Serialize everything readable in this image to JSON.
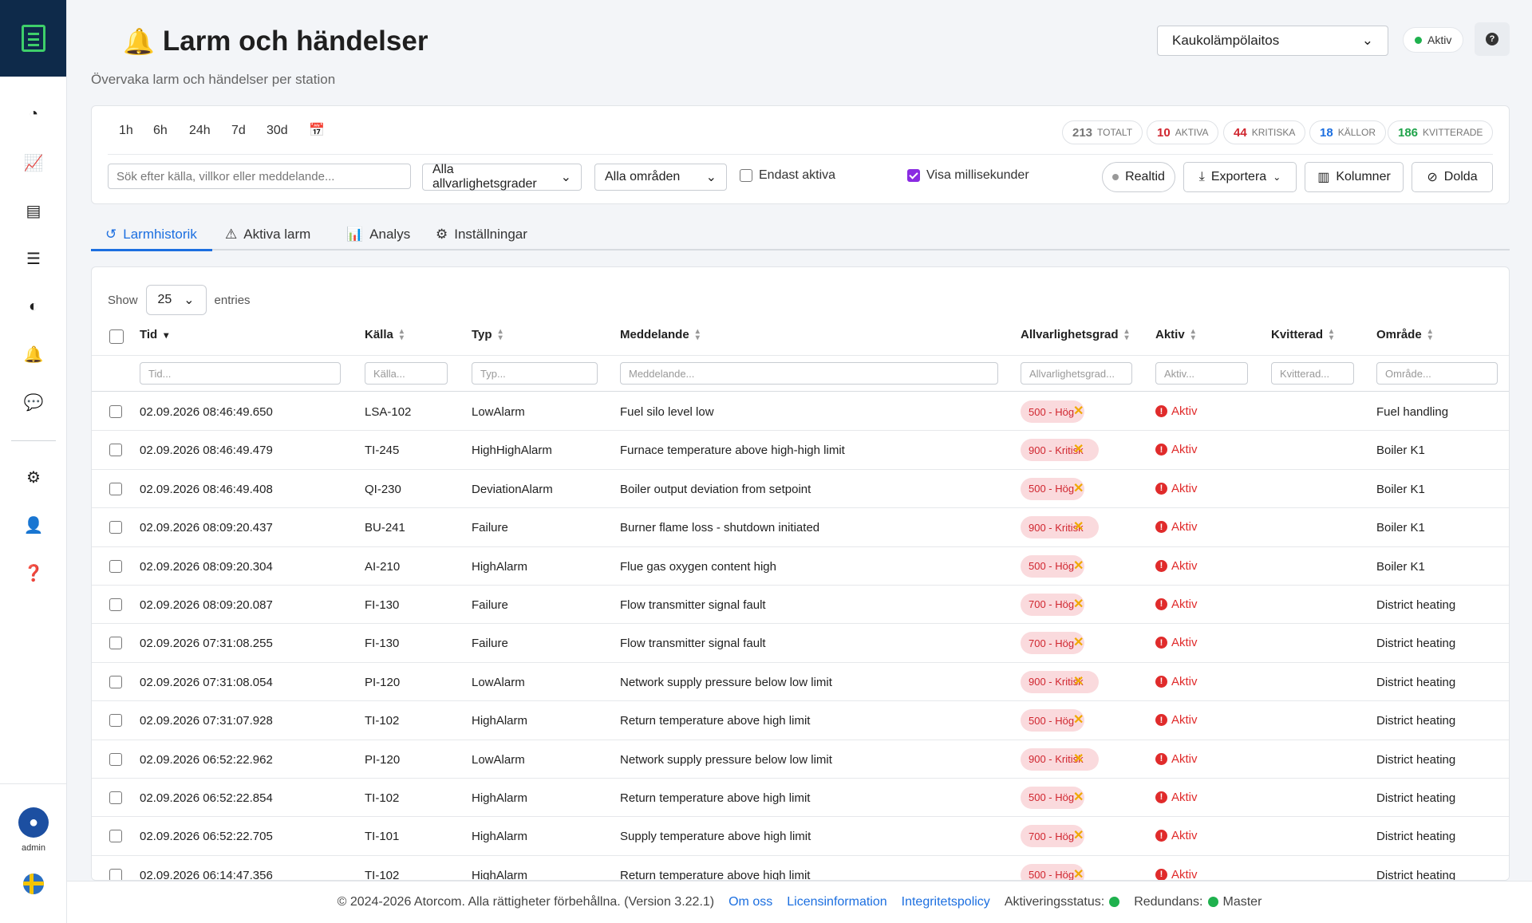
{
  "header": {
    "title": "Larm och händelser",
    "subtitle": "Övervaka larm och händelser per station",
    "station": "Kaukolämpölaitos",
    "status": "Aktiv",
    "help": "?"
  },
  "sidebar": {
    "user": "admin"
  },
  "ranges": [
    "1h",
    "6h",
    "24h",
    "7d",
    "30d"
  ],
  "stats": [
    {
      "num": "213",
      "label": "TOTALT",
      "color": "#222"
    },
    {
      "num": "10",
      "label": "AKTIVA",
      "color": "#d0262f"
    },
    {
      "num": "44",
      "label": "KRITISKA",
      "color": "#d0262f"
    },
    {
      "num": "18",
      "label": "KÄLLOR",
      "color": "#1c6fe0"
    },
    {
      "num": "186",
      "label": "KVITTERADE",
      "color": "#1fa34a"
    }
  ],
  "filters": {
    "search_placeholder": "Sök efter källa, villkor eller meddelande...",
    "severity": "Alla allvarlighetsgrader",
    "area": "Alla områden",
    "only_active": "Endast aktiva",
    "show_ms": "Visa millisekunder"
  },
  "tools": {
    "realtime": "Realtid",
    "export": "Exportera",
    "columns": "Kolumner",
    "hidden": "Dolda"
  },
  "tabs": [
    "Larmhistorik",
    "Aktiva larm",
    "Analys",
    "Inställningar"
  ],
  "table": {
    "show": "Show",
    "entries": "entries",
    "page_length": "25",
    "headers": [
      "Tid",
      "Källa",
      "Typ",
      "Meddelande",
      "Allvarlighetsgrad",
      "Aktiv",
      "Kvitterad",
      "Område"
    ],
    "filter_placeholders": [
      "Tid...",
      "Källa...",
      "Typ...",
      "Meddelande...",
      "Allvarlighetsgrad...",
      "Aktiv...",
      "Kvitterad...",
      "Område..."
    ],
    "rows": [
      {
        "time": "02.09.2026 08:46:49.650",
        "source": "LSA-102",
        "type": "LowAlarm",
        "message": "Fuel silo level low",
        "severity": "500 - Hög",
        "active": "Aktiv",
        "ack": "✕",
        "area": "Fuel handling"
      },
      {
        "time": "02.09.2026 08:46:49.479",
        "source": "TI-245",
        "type": "HighHighAlarm",
        "message": "Furnace temperature above high-high limit",
        "severity": "900 - Kritisk",
        "active": "Aktiv",
        "ack": "✕",
        "area": "Boiler K1"
      },
      {
        "time": "02.09.2026 08:46:49.408",
        "source": "QI-230",
        "type": "DeviationAlarm",
        "message": "Boiler output deviation from setpoint",
        "severity": "500 - Hög",
        "active": "Aktiv",
        "ack": "✕",
        "area": "Boiler K1"
      },
      {
        "time": "02.09.2026 08:09:20.437",
        "source": "BU-241",
        "type": "Failure",
        "message": "Burner flame loss - shutdown initiated",
        "severity": "900 - Kritisk",
        "active": "Aktiv",
        "ack": "✕",
        "area": "Boiler K1"
      },
      {
        "time": "02.09.2026 08:09:20.304",
        "source": "AI-210",
        "type": "HighAlarm",
        "message": "Flue gas oxygen content high",
        "severity": "500 - Hög",
        "active": "Aktiv",
        "ack": "✕",
        "area": "Boiler K1"
      },
      {
        "time": "02.09.2026 08:09:20.087",
        "source": "FI-130",
        "type": "Failure",
        "message": "Flow transmitter signal fault",
        "severity": "700 - Hög",
        "active": "Aktiv",
        "ack": "✕",
        "area": "District heating"
      },
      {
        "time": "02.09.2026 07:31:08.255",
        "source": "FI-130",
        "type": "Failure",
        "message": "Flow transmitter signal fault",
        "severity": "700 - Hög",
        "active": "Aktiv",
        "ack": "✕",
        "area": "District heating"
      },
      {
        "time": "02.09.2026 07:31:08.054",
        "source": "PI-120",
        "type": "LowAlarm",
        "message": "Network supply pressure below low limit",
        "severity": "900 - Kritisk",
        "active": "Aktiv",
        "ack": "✕",
        "area": "District heating"
      },
      {
        "time": "02.09.2026 07:31:07.928",
        "source": "TI-102",
        "type": "HighAlarm",
        "message": "Return temperature above high limit",
        "severity": "500 - Hög",
        "active": "Aktiv",
        "ack": "✕",
        "area": "District heating"
      },
      {
        "time": "02.09.2026 06:52:22.962",
        "source": "PI-120",
        "type": "LowAlarm",
        "message": "Network supply pressure below low limit",
        "severity": "900 - Kritisk",
        "active": "Aktiv",
        "ack": "✕",
        "area": "District heating"
      },
      {
        "time": "02.09.2026 06:52:22.854",
        "source": "TI-102",
        "type": "HighAlarm",
        "message": "Return temperature above high limit",
        "severity": "500 - Hög",
        "active": "Aktiv",
        "ack": "✕",
        "area": "District heating"
      },
      {
        "time": "02.09.2026 06:52:22.705",
        "source": "TI-101",
        "type": "HighAlarm",
        "message": "Supply temperature above high limit",
        "severity": "700 - Hög",
        "active": "Aktiv",
        "ack": "✕",
        "area": "District heating"
      },
      {
        "time": "02.09.2026 06:14:47.356",
        "source": "TI-102",
        "type": "HighAlarm",
        "message": "Return temperature above high limit",
        "severity": "500 - Hög",
        "active": "Aktiv",
        "ack": "✕",
        "area": "District heating"
      }
    ]
  },
  "footer": {
    "copyright": "© 2024-2026 Atorcom. Alla rättigheter förbehållna. (Version 3.22.1)",
    "about": "Om oss",
    "license": "Licensinformation",
    "privacy": "Integritetspolicy",
    "activation": "Aktiveringsstatus:",
    "redundancy": "Redundans:",
    "master": "Master"
  }
}
